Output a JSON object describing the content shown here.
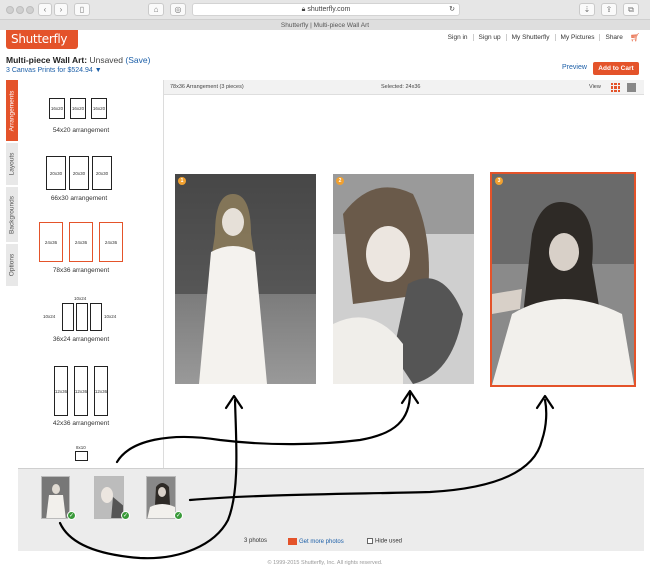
{
  "browser": {
    "url": "shutterfly.com",
    "tab_title": "Shutterfly | Multi-piece Wall Art"
  },
  "header": {
    "logo": "Shutterfly",
    "links": [
      "Sign in",
      "Sign up",
      "My Shutterfly",
      "My Pictures",
      "Share"
    ],
    "project_title": "Multi-piece Wall Art:",
    "project_status": "Unsaved",
    "save_label": "(Save)",
    "price_line": "3 Canvas Prints for $524.94",
    "preview_label": "Preview",
    "add_to_cart_label": "Add to Cart"
  },
  "tabs": [
    "Arrangements",
    "Layouts",
    "Backgrounds",
    "Options"
  ],
  "arrangements": [
    {
      "label": "54x20 arrangement",
      "boxes": [
        "16x20",
        "16x20",
        "16x20"
      ]
    },
    {
      "label": "66x30 arrangement",
      "boxes": [
        "20x30",
        "20x30",
        "20x30"
      ]
    },
    {
      "label": "78x36 arrangement",
      "boxes": [
        "24x36",
        "24x36",
        "24x36"
      ],
      "selected": true
    },
    {
      "label": "36x24 arrangement",
      "boxes": [
        "10x24",
        "10x24",
        "10x24"
      ]
    },
    {
      "label": "42x36 arrangement",
      "boxes": [
        "12x36",
        "12x36",
        "12x36"
      ]
    },
    {
      "label": "",
      "boxes": [
        "8x10"
      ]
    }
  ],
  "toolbar": {
    "arrangement_info": "78x36 Arrangement (3 pieces)",
    "selected_info": "Selected: 24x36",
    "view_label": "View"
  },
  "canvas": {
    "badges": [
      "1",
      "2",
      "3"
    ]
  },
  "filmstrip": {
    "count_label": "3 photos",
    "get_more_label": "Get more photos",
    "hide_used_label": "Hide used"
  },
  "footer": "© 1999-2015 Shutterfly, Inc. All rights reserved.",
  "colors": {
    "brand": "#e4532a",
    "link": "#1c5fa8"
  }
}
